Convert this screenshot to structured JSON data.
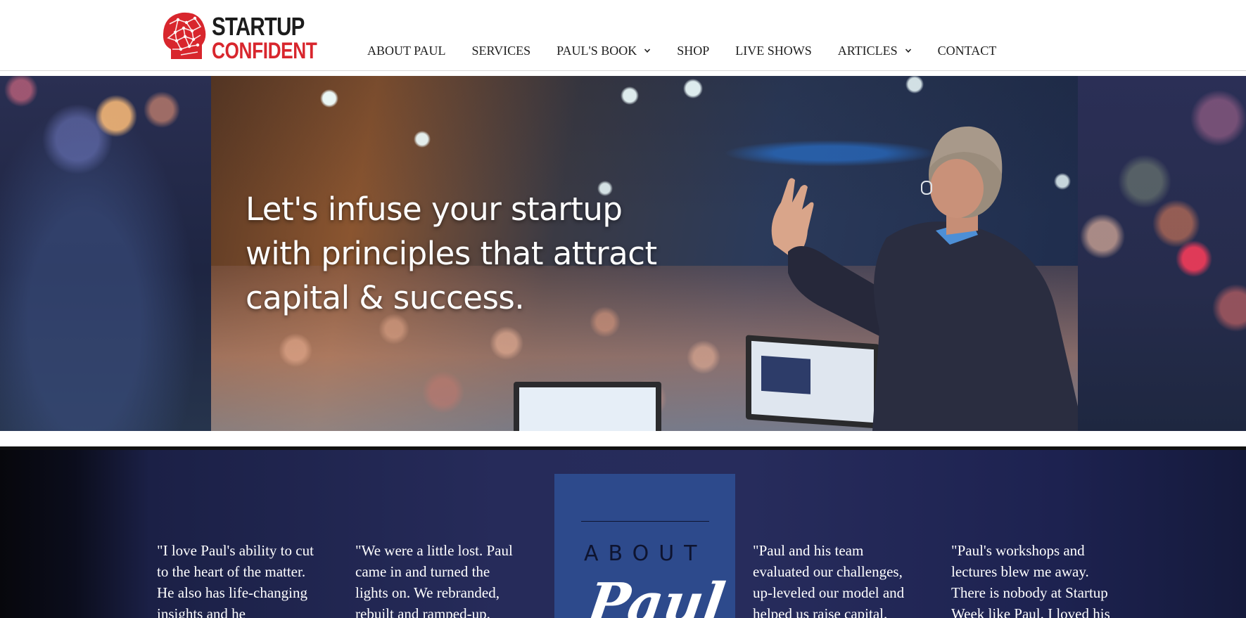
{
  "brand": {
    "line1": "STARTUP",
    "line2": "CONFIDENT",
    "icon": "head-network-icon",
    "colors": {
      "dark": "#1c1c1c",
      "red": "#d8262d"
    }
  },
  "nav": {
    "items": [
      {
        "label": "ABOUT PAUL",
        "dropdown": false
      },
      {
        "label": "SERVICES",
        "dropdown": false
      },
      {
        "label": "PAUL'S BOOK",
        "dropdown": true
      },
      {
        "label": "SHOP",
        "dropdown": false
      },
      {
        "label": "LIVE SHOWS",
        "dropdown": false
      },
      {
        "label": "ARTICLES",
        "dropdown": true
      },
      {
        "label": "CONTACT",
        "dropdown": false
      }
    ]
  },
  "hero": {
    "line1": "Let's infuse your startup",
    "line2": "with principles that attract",
    "line3": "capital & success."
  },
  "about": {
    "card_top": "ABOUT",
    "card_name": "Paul",
    "accent": "#2d4a8c",
    "quotes": [
      {
        "lines": [
          "\"I love Paul's ability to cut",
          "to the heart of the matter.",
          "He also has life-changing",
          "insights and he"
        ]
      },
      {
        "lines": [
          "\"We were a little lost. Paul",
          "came in and turned the",
          "lights on. We rebranded,",
          "rebuilt and ramped-up."
        ]
      },
      {
        "lines": [
          "\"Paul and his team",
          "evaluated our challenges,",
          "up-leveled our model and",
          "helped us raise capital."
        ]
      },
      {
        "lines": [
          "\"Paul's workshops and",
          "lectures blew me away.",
          "There is nobody at Startup",
          "Week like Paul. I loved his"
        ]
      }
    ]
  }
}
